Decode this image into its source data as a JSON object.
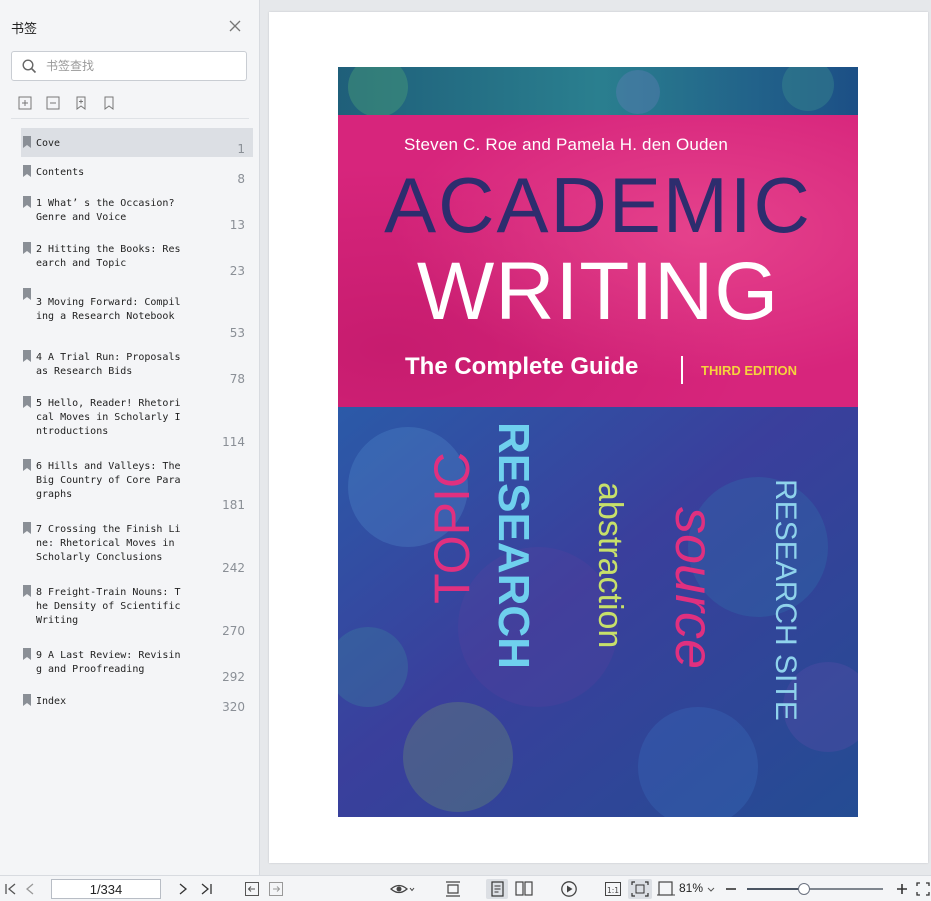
{
  "sidebar": {
    "title": "书签",
    "search_placeholder": "书签查找",
    "bookmarks": [
      {
        "label": "Cove",
        "page": "1"
      },
      {
        "label": "Contents",
        "page": "8"
      },
      {
        "label": "1 What’ s the Occasion?\nGenre and Voice",
        "page": "13"
      },
      {
        "label": "2 Hitting the Books: Res\nearch and Topic",
        "page": "23"
      },
      {
        "label": "3 Moving Forward: Compil\ning a Research Notebook",
        "page": "53"
      },
      {
        "label": "4 A Trial Run: Proposals\nas Research Bids",
        "page": "78"
      },
      {
        "label": "5 Hello, Reader! Rhetori\ncal Moves in Scholarly I\nntroductions",
        "page": "114"
      },
      {
        "label": "6 Hills and Valleys: The\nBig Country of Core Para\ngraphs",
        "page": "181"
      },
      {
        "label": "7 Crossing the Finish Li\nne: Rhetorical Moves in\nScholarly Conclusions",
        "page": "242"
      },
      {
        "label": "8 Freight-Train Nouns: T\nhe Density of Scientific\nWriting",
        "page": "270"
      },
      {
        "label": "9 A Last Review: Revisin\ng and Proofreading",
        "page": "292"
      },
      {
        "label": "Index",
        "page": "320"
      }
    ]
  },
  "cover": {
    "authors": "Steven C. Roe and Pamela H. den Ouden",
    "title_line1": "ACADEMIC",
    "title_line2": "WRITING",
    "subtitle": "The Complete Guide",
    "edition": "THIRD EDITION",
    "words": {
      "research_a": "RESEARCH",
      "topic": "TOPIC",
      "abstraction": "abstraction",
      "source": "source",
      "research_site": "RESEARCH SITE"
    },
    "colors": {
      "band": "#d7257c",
      "title": "#2d2d6e",
      "edition": "#f6d33d",
      "background": "#2e3f8f"
    }
  },
  "toolbar": {
    "page_indicator": "1/334",
    "zoom": "81%",
    "zoom_level": 0.42
  }
}
